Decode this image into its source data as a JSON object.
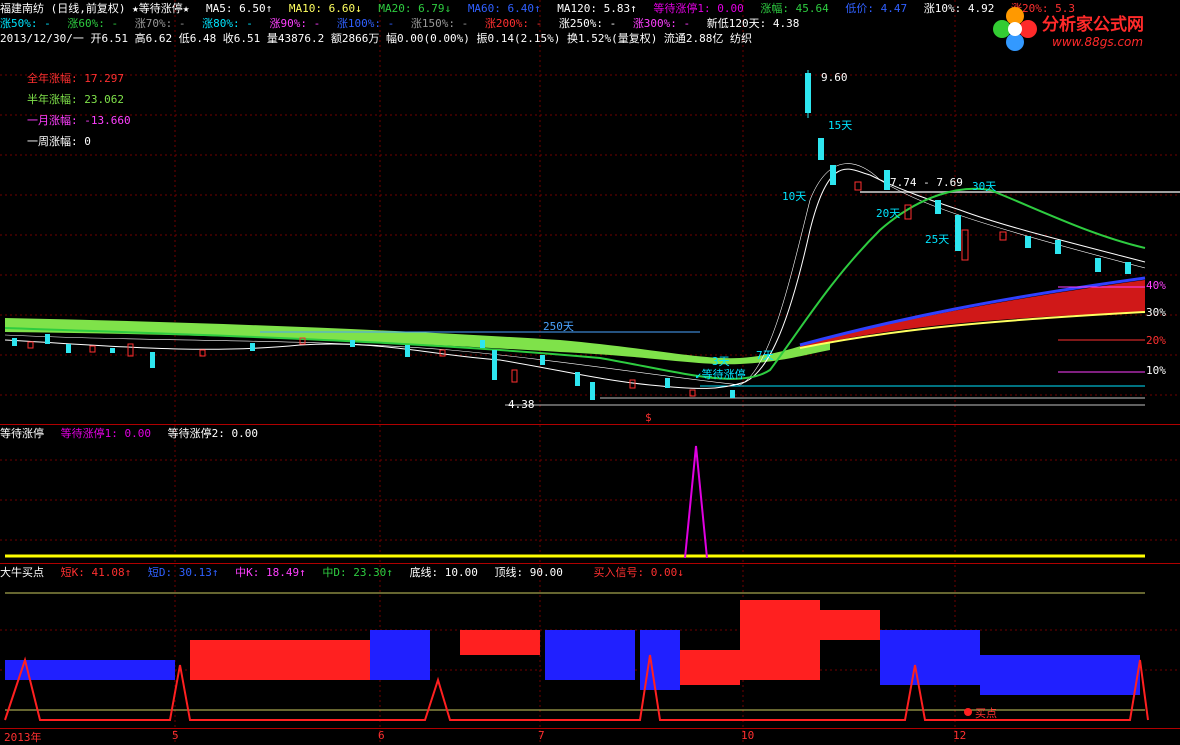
{
  "colors": {
    "up": "#ff3030",
    "down": "#2ee6f0",
    "ma5": "#ffffff",
    "ma10": "#ffff60",
    "ma20": "#2ecc40",
    "ma60": "#3060ff",
    "ma120": "#ffffff",
    "signal": "#e000e0",
    "cyan": "#00e5ff",
    "green": "#00ff00",
    "magenta": "#ff40ff",
    "yellow": "#ffff00"
  },
  "header": {
    "stock": "福建南纺 (日线,前复权) ★等待涨停★",
    "ma5": "MA5: 6.50↑",
    "ma10": "MA10: 6.60↓",
    "ma20": "MA20: 6.79↓",
    "ma60": "MA60: 6.40↑",
    "ma120": "MA120: 5.83↑",
    "wait1": "等待涨停1: 0.00",
    "gain": "涨幅: 45.64",
    "low": "低价: 4.47",
    "z10": "涨10%: 4.92",
    "z20": "涨20%: 5.3"
  },
  "header2": {
    "z50": "涨50%: -",
    "z60": "涨60%: -",
    "z70": "涨70%: -",
    "z80": "涨80%: -",
    "z90": "涨90%: -",
    "z100": "涨100%: -",
    "z150": "涨150%: -",
    "z200": "涨200%: -",
    "z250": "涨250%: -",
    "z300": "涨300%: -",
    "newlow": "新低120天: 4.38"
  },
  "header3": "2013/12/30/一 开6.51 高6.62 低6.48 收6.51 量43876.2 额2866万 幅0.00(0.00%) 振0.14(2.15%) 换1.52%(量复权) 流通2.88亿 纺织",
  "stats": {
    "year": "全年涨幅: 17.297",
    "half": "半年涨幅: 23.062",
    "month": "一月涨幅: -13.660",
    "week": "一周涨幅: 0"
  },
  "annotations": {
    "peak": "9.60",
    "d15": "15天",
    "d10": "10天",
    "range": "7.74 - 7.69",
    "d30": "30天",
    "d20": "20天",
    "d25": "25天",
    "d250": "250天",
    "d3": "3天",
    "d7": "7天",
    "wait": "↙等待涨停",
    "low_mark": "4.38",
    "dollar": "$",
    "p40": "40%",
    "p30": "30%",
    "p20": "20%",
    "p10": "10%"
  },
  "panel2": {
    "title": "等待涨停",
    "w1": "等待涨停1: 0.00",
    "w2": "等待涨停2: 0.00"
  },
  "panel3": {
    "title": "大牛买点",
    "shortk": "短K: 41.08↑",
    "shortd": "短D: 30.13↑",
    "midk": "中K: 18.49↑",
    "midd": "中D: 23.30↑",
    "bottom": "底线: 10.00",
    "top": "顶线: 90.00",
    "buy": "买入信号: 0.00↓",
    "buy_label": "买点"
  },
  "xaxis": [
    "2013年",
    "5",
    "6",
    "7",
    "10",
    "12"
  ],
  "logo": {
    "name": "分析家公式网",
    "url": "www.88gs.com"
  }
}
